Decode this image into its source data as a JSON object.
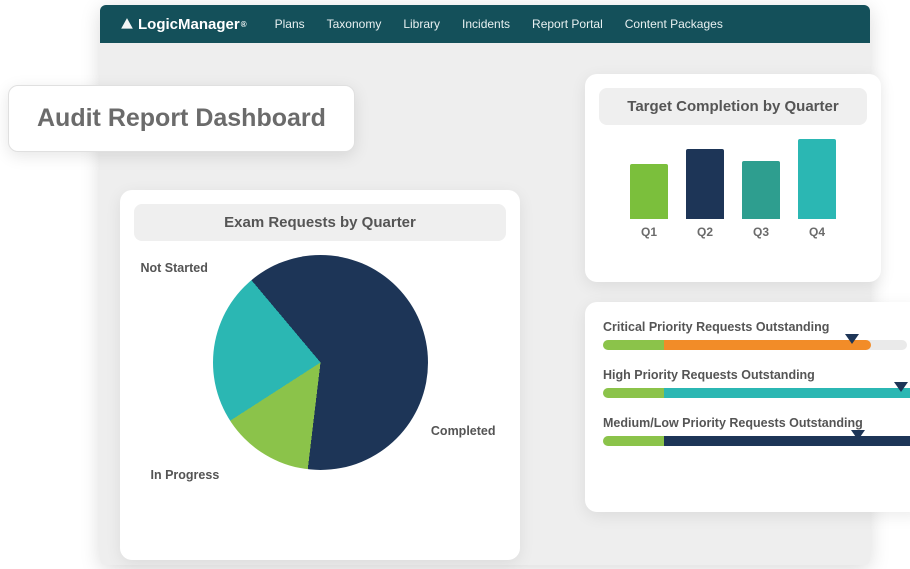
{
  "brand": "LogicManager",
  "nav": {
    "items": [
      "Plans",
      "Taxonomy",
      "Library",
      "Incidents",
      "Report Portal",
      "Content Packages"
    ]
  },
  "page_title": "Audit Report Dashboard",
  "bar_card": {
    "title": "Target Completion by Quarter"
  },
  "pie_card": {
    "title": "Exam Requests by Quarter",
    "labels": {
      "not_started": "Not Started",
      "in_progress": "In Progress",
      "completed": "Completed"
    }
  },
  "progress": {
    "rows": [
      {
        "title": "Critical Priority Requests Outstanding"
      },
      {
        "title": "High Priority Requests Outstanding"
      },
      {
        "title": "Medium/Low Priority Requests Outstanding"
      }
    ]
  },
  "chart_data": [
    {
      "type": "bar",
      "title": "Target Completion by Quarter",
      "categories": [
        "Q1",
        "Q2",
        "Q3",
        "Q4"
      ],
      "values": [
        55,
        70,
        58,
        80
      ],
      "colors": [
        "#7bbf3c",
        "#1d3557",
        "#2e9e8f",
        "#2bb7b3"
      ],
      "ylim": [
        0,
        100
      ]
    },
    {
      "type": "pie",
      "title": "Exam Requests by Quarter",
      "series": [
        {
          "name": "Not Started",
          "value": 63,
          "color": "#1d3557"
        },
        {
          "name": "Completed",
          "value": 14,
          "color": "#8bc34a"
        },
        {
          "name": "In Progress",
          "value": 23,
          "color": "#2bb7b3"
        }
      ]
    },
    {
      "type": "bar",
      "title": "Priority Requests Outstanding",
      "categories": [
        "Critical",
        "High",
        "Medium/Low"
      ],
      "series": [
        {
          "name": "seg1_pct",
          "values": [
            20,
            20,
            20
          ],
          "color": "#8bc34a"
        },
        {
          "name": "seg2_pct",
          "values": [
            68,
            88,
            95
          ],
          "colors": [
            "#f28c28",
            "#2bb7b3",
            "#1d3557"
          ]
        },
        {
          "name": "marker_pct",
          "values": [
            82,
            98,
            84
          ]
        }
      ]
    }
  ]
}
